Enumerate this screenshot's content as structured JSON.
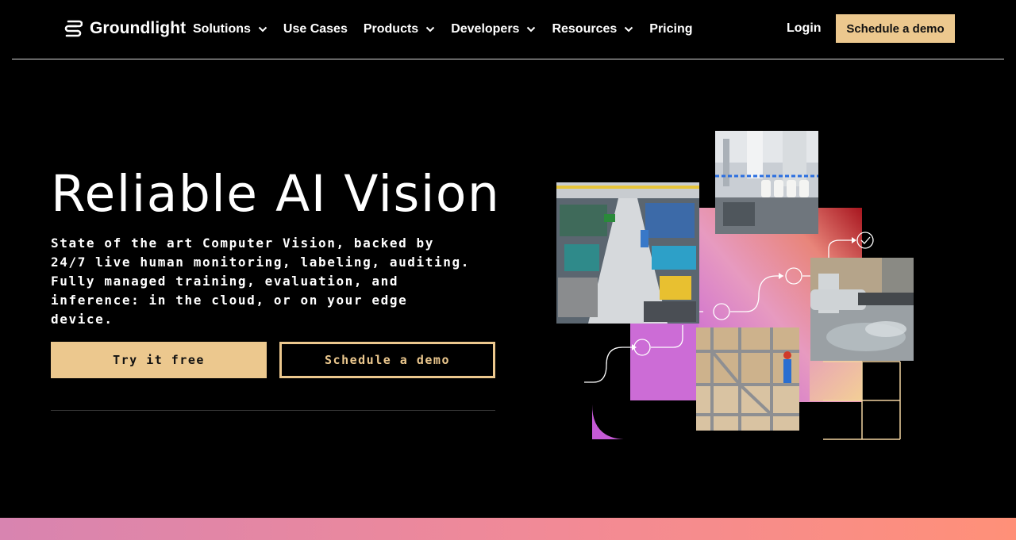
{
  "brand": {
    "name": "Groundlight"
  },
  "nav": {
    "items": [
      {
        "label": "Solutions",
        "has_dropdown": true
      },
      {
        "label": "Use Cases",
        "has_dropdown": false
      },
      {
        "label": "Products",
        "has_dropdown": true
      },
      {
        "label": "Developers",
        "has_dropdown": true
      },
      {
        "label": "Resources",
        "has_dropdown": true
      },
      {
        "label": "Pricing",
        "has_dropdown": false
      }
    ],
    "login_label": "Login",
    "demo_label": "Schedule a demo"
  },
  "hero": {
    "title": "Reliable AI Vision",
    "subtitle": "State of the art Computer Vision, backed by 24/7 live human monitoring, labeling, auditing. Fully managed training, evaluation, and inference: in the cloud, or on your edge device.",
    "primary_cta": "Try it free",
    "secondary_cta": "Schedule a demo"
  },
  "colors": {
    "accent": "#ecc88e",
    "background": "#000000",
    "grid_gradient": [
      "#c96ad6",
      "#f0a0b4",
      "#b3202f"
    ],
    "bottom_band": [
      "#d884b0",
      "#ff9078"
    ]
  },
  "icons": [
    "logo-icon",
    "chevron-down-icon",
    "check-circle-icon"
  ]
}
